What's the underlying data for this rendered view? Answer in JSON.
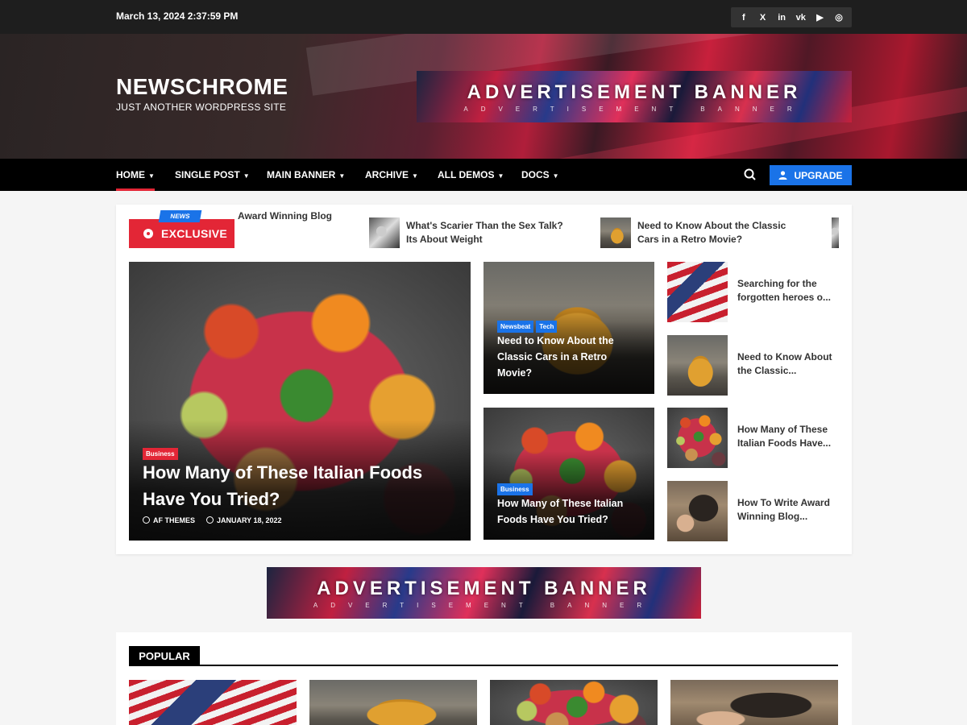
{
  "topbar": {
    "date": "March 13, 2024 2:37:59 PM",
    "social": [
      {
        "icon": "facebook-icon",
        "glyph": "f"
      },
      {
        "icon": "x-twitter-icon",
        "glyph": "X"
      },
      {
        "icon": "linkedin-icon",
        "glyph": "in"
      },
      {
        "icon": "vk-icon",
        "glyph": "vk"
      },
      {
        "icon": "youtube-icon",
        "glyph": "▶"
      },
      {
        "icon": "instagram-icon",
        "glyph": "◎"
      }
    ]
  },
  "header": {
    "site_title": "NEWSCHROME",
    "tagline": "JUST ANOTHER WORDPRESS SITE",
    "ad_main": "ADVERTISEMENT BANNER",
    "ad_sub": "ADVERTISEMENT BANNER"
  },
  "nav": {
    "items": [
      "HOME",
      "SINGLE POST",
      "MAIN BANNER",
      "ARCHIVE",
      "ALL DEMOS",
      "DOCS"
    ],
    "chevron": "▼",
    "upgrade": "UPGRADE"
  },
  "ticker": {
    "badge": "NEWS",
    "label": "EXCLUSIVE",
    "items": [
      "Award Winning Blog",
      "What's Scarier Than the Sex Talk? Its About Weight",
      "Need to Know About the Classic Cars in a Retro Movie?"
    ]
  },
  "featured": {
    "category": "Business",
    "title": "How Many of These Italian Foods Have You Tried?",
    "author": "AF THEMES",
    "date": "JANUARY 18, 2022"
  },
  "middle": [
    {
      "categories": [
        "Newsbeat",
        "Tech"
      ],
      "title": "Need to Know About the Classic Cars in a Retro Movie?"
    },
    {
      "categories": [
        "Business"
      ],
      "title": "How Many of These Italian Foods Have You Tried?"
    }
  ],
  "sidebar_posts": [
    "Searching for the forgotten heroes o...",
    "Need to Know About the Classic...",
    "How Many of These Italian Foods Have...",
    "How To Write Award Winning Blog..."
  ],
  "mid_ad": {
    "main": "ADVERTISEMENT BANNER",
    "sub": "ADVERTISEMENT BANNER"
  },
  "popular": {
    "label": "POPULAR"
  },
  "colors": {
    "accent_red": "#e32636",
    "accent_blue": "#1a73e8",
    "topbar": "#1e1e1e",
    "nav": "#000000"
  }
}
